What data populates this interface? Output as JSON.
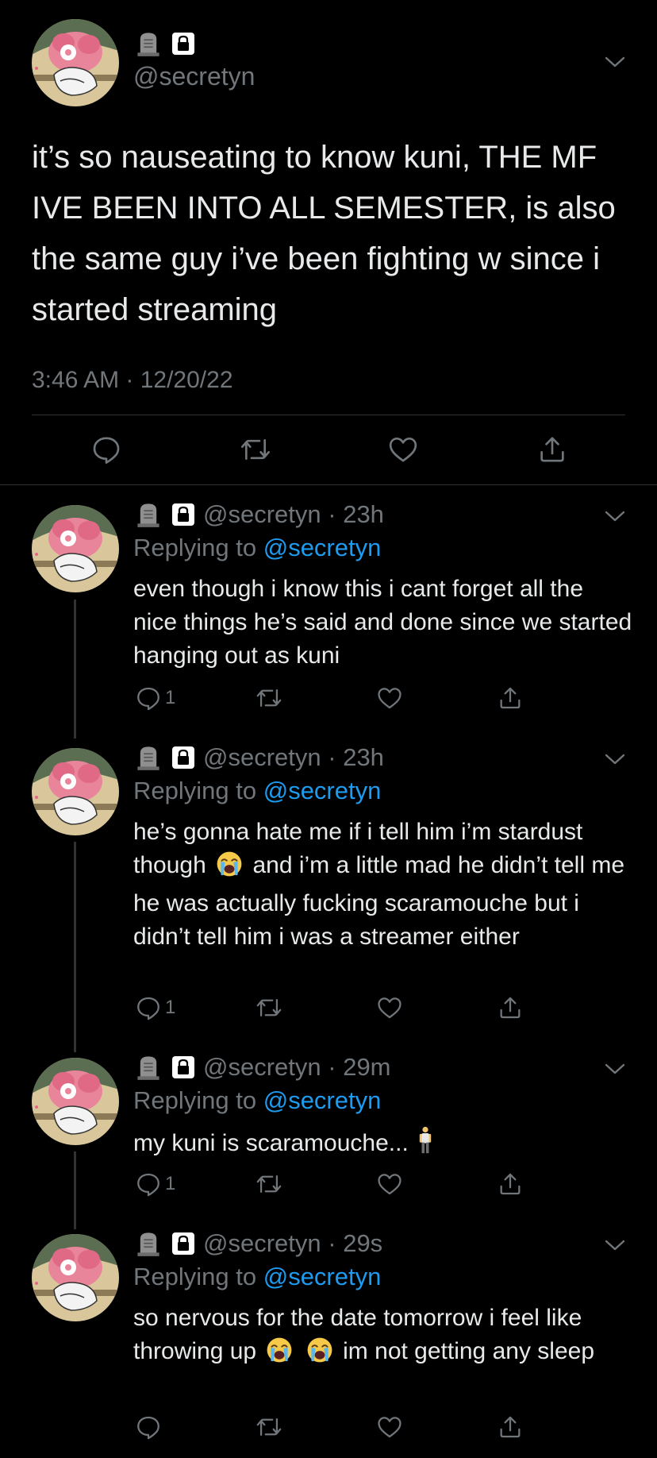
{
  "main_tweet": {
    "handle": "@secretyn",
    "text": "it’s so nauseating to know kuni, THE MF IVE BEEN INTO ALL SEMESTER, is also the same guy i’ve been fighting w since i started streaming",
    "timestamp": "3:46 AM · 12/20/22"
  },
  "replies": [
    {
      "handle": "@secretyn",
      "time": "23h",
      "replying_label": "Replying to",
      "replying_to": "@secretyn",
      "text_parts": [
        "even though i know this i cant forget all the nice things he’s said and done since we started hanging out as kuni"
      ],
      "reply_count": "1"
    },
    {
      "handle": "@secretyn",
      "time": "23h",
      "replying_label": "Replying to",
      "replying_to": "@secretyn",
      "text_parts": [
        "he’s gonna hate me if i tell him i’m stardust though",
        "and i’m a little mad he didn’t tell me he was actually fucking scaramouche but i didn’t tell him i was a streamer either"
      ],
      "reply_count": "1"
    },
    {
      "handle": "@secretyn",
      "time": "29m",
      "replying_label": "Replying to",
      "replying_to": "@secretyn",
      "text_parts": [
        "my kuni is scaramouche..."
      ],
      "reply_count": "1"
    },
    {
      "handle": "@secretyn",
      "time": "29s",
      "replying_label": "Replying to",
      "replying_to": "@secretyn",
      "text_parts": [
        "so nervous for the date tomorrow i feel like throwing up",
        "im not getting any sleep"
      ],
      "reply_count": ""
    }
  ],
  "separator": " · ",
  "icons": [
    "tombstone-icon",
    "lock-icon",
    "chevron-down-icon",
    "reply-icon",
    "retweet-icon",
    "like-icon",
    "share-icon",
    "crying-face-emoji",
    "person-standing-emoji"
  ],
  "colors": {
    "background": "#000000",
    "text": "#e7e9ea",
    "muted": "#71767b",
    "link": "#1d9bf0"
  }
}
